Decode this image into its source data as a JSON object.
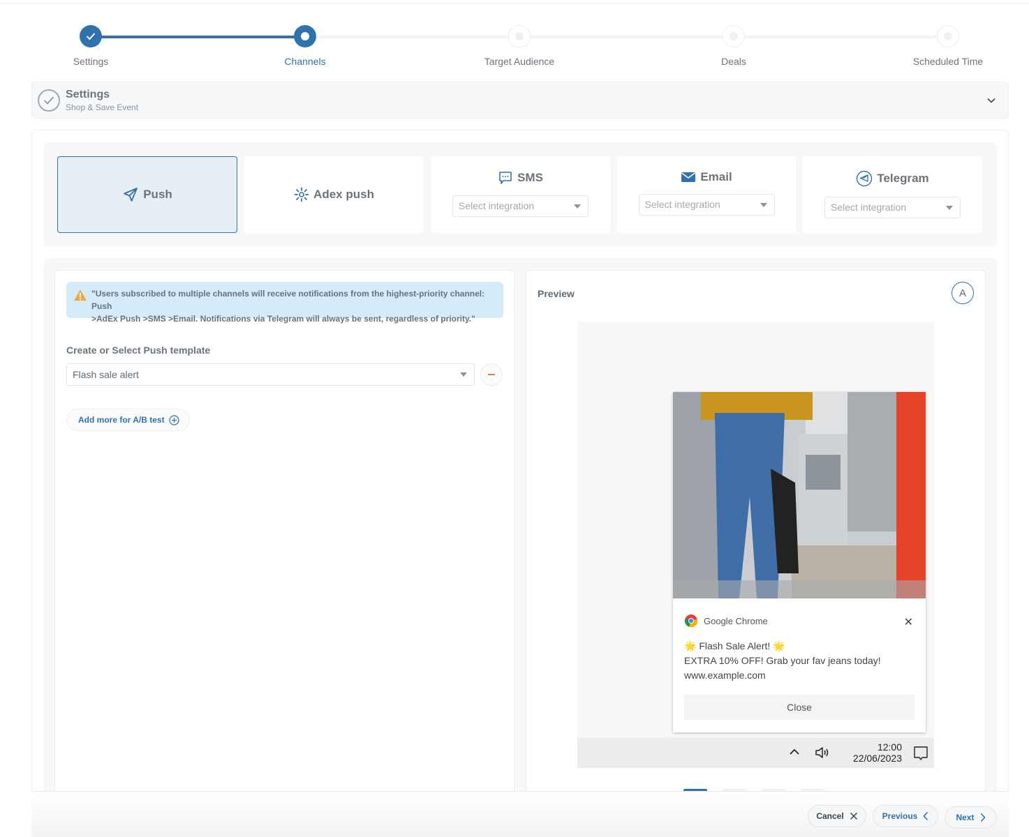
{
  "stepper": {
    "steps": [
      {
        "label": "Settings",
        "state": "done"
      },
      {
        "label": "Channels",
        "state": "active"
      },
      {
        "label": "Target Audience",
        "state": "pending"
      },
      {
        "label": "Deals",
        "state": "pending"
      },
      {
        "label": "Scheduled Time",
        "state": "pending"
      }
    ]
  },
  "summary": {
    "title": "Settings",
    "subtitle": "Shop & Save Event"
  },
  "channels": {
    "items": [
      {
        "label": "Push",
        "icon": "send-icon",
        "selected": true
      },
      {
        "label": "Adex push",
        "icon": "sparkle-icon",
        "selected": false
      },
      {
        "label": "SMS",
        "icon": "chat-icon",
        "selected": false,
        "placeholder": "Select integration"
      },
      {
        "label": "Email",
        "icon": "envelope-icon",
        "selected": false,
        "placeholder": "Select integration"
      },
      {
        "label": "Telegram",
        "icon": "telegram-icon",
        "selected": false,
        "placeholder": "Select integration"
      }
    ]
  },
  "editor": {
    "alert_line1": "\"Users subscribed to multiple channels will receive notifications from the highest-priority channel: Push",
    "alert_line2": ">AdEx Push >SMS >Email. Notifications via Telegram will always be sent, regardless of priority.\"",
    "template_label": "Create or Select Push template",
    "template_value": "Flash sale alert",
    "ab_button": "Add more for A/B test"
  },
  "preview": {
    "title": "Preview",
    "variant": "A",
    "notification": {
      "app": "Google Chrome",
      "title": "🌟 Flash Sale Alert! 🌟",
      "body": "EXTRA 10% OFF! Grab your fav jeans today!",
      "url": "www.example.com",
      "button": "Close"
    },
    "taskbar": {
      "time": "12:00",
      "date": "22/06/2023"
    },
    "carousel_active": 1,
    "carousel_count": 4
  },
  "footer": {
    "cancel": "Cancel",
    "previous": "Previous",
    "next": "Next"
  },
  "colors": {
    "accent": "#2f72ad",
    "alert_bg": "#d4ebfa",
    "warning": "#f0a742",
    "danger": "#e07a5f"
  }
}
